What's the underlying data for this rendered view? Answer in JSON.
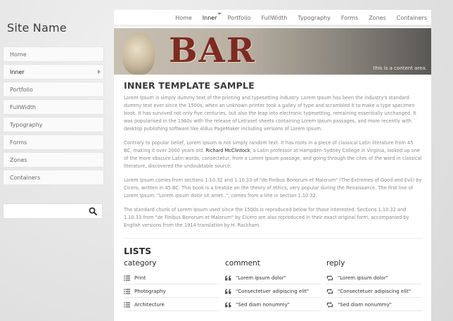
{
  "site": {
    "name": "Site Name"
  },
  "sidebar": {
    "items": [
      {
        "label": "Home"
      },
      {
        "label": "Inner"
      },
      {
        "label": "Portfolio"
      },
      {
        "label": "FullWidth"
      },
      {
        "label": "Typography"
      },
      {
        "label": "Forms"
      },
      {
        "label": "Zones"
      },
      {
        "label": "Containers"
      }
    ],
    "search": {
      "placeholder": "",
      "icon": "search-icon"
    }
  },
  "topnav": {
    "items": [
      {
        "label": "Home"
      },
      {
        "label": "Inner"
      },
      {
        "label": "Portfolio"
      },
      {
        "label": "FullWidth"
      },
      {
        "label": "Typography"
      },
      {
        "label": "Forms"
      },
      {
        "label": "Zones"
      },
      {
        "label": "Containers"
      }
    ]
  },
  "banner": {
    "text": "BAR",
    "caption": "this is a content area."
  },
  "main": {
    "title": "INNER TEMPLATE SAMPLE",
    "p1": "Lorem Ipsum is simply dummy text of the printing and typesetting industry. Lorem Ipsum has been the industry's standard dummy text ever since the 1500s, when an unknown printer took a galley of type and scrambled it to make a type specimen book. It has survived not only five centuries, but also the leap into electronic typesetting, remaining essentially unchanged. It was popularised in the 1960s with the release of Letraset sheets containing Lorem Ipsum passages, and more recently with desktop publishing software like Aldus PageMaker including versions of Lorem Ipsum.",
    "p2_before": "Contrary to popular belief, Lorem Ipsum is not simply random text. It has roots in a piece of classical Latin literature from 45 BC, making it over 2000 years old. ",
    "p2_link": "Richard McClintock",
    "p2_after": ", a Latin professor at Hampden-Sydney College in Virginia, looked up one of the more obscure Latin words, consectetur, from a Lorem Ipsum passage, and going through the cites of the word in classical literature, discovered the undoubtable source.",
    "p3": "Lorem Ipsum comes from sections 1.10.32 and 1.10.33 of \"de Finibus Bonorum et Malorum\" (The Extremes of Good and Evil) by Cicero, written in 45 BC. This book is a treatise on the theory of ethics, very popular during the Renaissance. The first line of Lorem Ipsum, \"Lorem ipsum dolor sit amet..\", comes from a line in section 1.10.32.",
    "p4": "The standard chunk of Lorem Ipsum used since the 1500s is reproduced below for those interested. Sections 1.10.32 and 1.10.33 from \"de Finibus Bonorum et Malorum\" by Cicero are also reproduced in their exact original form, accompanied by English versions from the 1914 translation by H. Rackham."
  },
  "lists": {
    "title": "LISTS",
    "columns": [
      {
        "heading": "category",
        "icon": "list-icon",
        "items": [
          "Print",
          "Photography",
          "Architecture"
        ]
      },
      {
        "heading": "comment",
        "icon": "quote-icon",
        "items": [
          "\"Lorem ipsum dolor\"",
          "\"Consectetuer adipiscing elit\"",
          "\"Sed diam nonummy\""
        ]
      },
      {
        "heading": "reply",
        "icon": "retweet-icon",
        "items": [
          "\"Lorem ipsum dolor\"",
          "\"Consectetuer adipiscing elit\"",
          "\"Sed diam nonummy\""
        ]
      }
    ]
  },
  "colors": {
    "accent": "#7d2a22",
    "text": "#3a3a3a",
    "muted": "#8a8a8a"
  }
}
